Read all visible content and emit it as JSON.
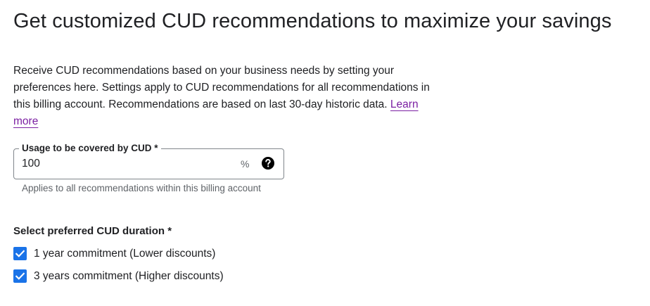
{
  "header": {
    "title": "Get customized CUD recommendations to maximize your savings"
  },
  "description": {
    "text": "Receive CUD recommendations based on your business needs by setting your preferences here. Settings apply to CUD recommendations for all recommendations in this billing account. Recommendations are based on last 30-day historic data.",
    "link_label": "Learn more"
  },
  "usage_field": {
    "label": "Usage to be covered by CUD *",
    "value": "100",
    "suffix": "%",
    "help_icon": "help-circle-icon",
    "hint": "Applies to all recommendations within this billing account"
  },
  "duration": {
    "label": "Select preferred CUD duration *",
    "options": [
      {
        "label": "1 year commitment (Lower discounts)",
        "checked": true
      },
      {
        "label": "3 years commitment (Higher discounts)",
        "checked": true
      }
    ]
  },
  "colors": {
    "accent": "#1a73e8",
    "link": "#7b1fa2",
    "text": "#202124",
    "secondary_text": "#5f6368",
    "border": "#80868b"
  }
}
